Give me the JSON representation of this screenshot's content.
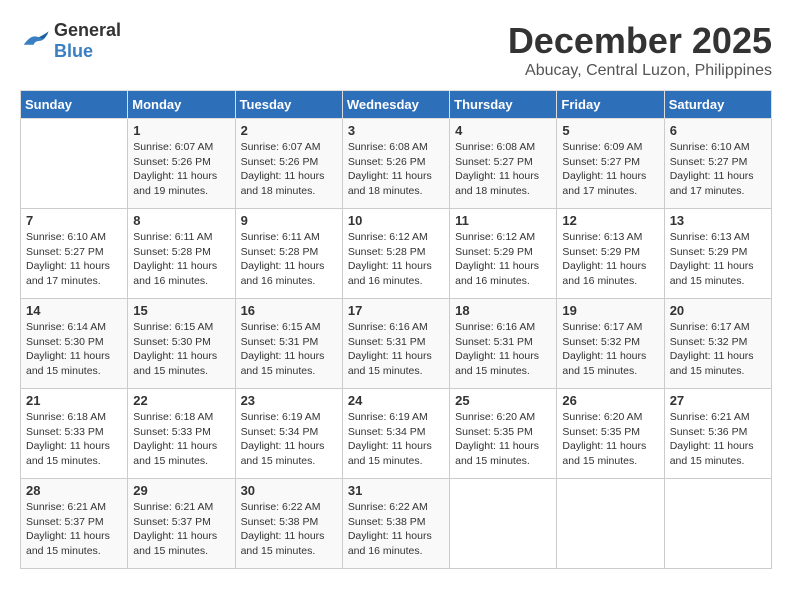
{
  "logo": {
    "general": "General",
    "blue": "Blue"
  },
  "title": {
    "month": "December 2025",
    "location": "Abucay, Central Luzon, Philippines"
  },
  "headers": [
    "Sunday",
    "Monday",
    "Tuesday",
    "Wednesday",
    "Thursday",
    "Friday",
    "Saturday"
  ],
  "weeks": [
    [
      {
        "day": "",
        "info": ""
      },
      {
        "day": "1",
        "info": "Sunrise: 6:07 AM\nSunset: 5:26 PM\nDaylight: 11 hours\nand 19 minutes."
      },
      {
        "day": "2",
        "info": "Sunrise: 6:07 AM\nSunset: 5:26 PM\nDaylight: 11 hours\nand 18 minutes."
      },
      {
        "day": "3",
        "info": "Sunrise: 6:08 AM\nSunset: 5:26 PM\nDaylight: 11 hours\nand 18 minutes."
      },
      {
        "day": "4",
        "info": "Sunrise: 6:08 AM\nSunset: 5:27 PM\nDaylight: 11 hours\nand 18 minutes."
      },
      {
        "day": "5",
        "info": "Sunrise: 6:09 AM\nSunset: 5:27 PM\nDaylight: 11 hours\nand 17 minutes."
      },
      {
        "day": "6",
        "info": "Sunrise: 6:10 AM\nSunset: 5:27 PM\nDaylight: 11 hours\nand 17 minutes."
      }
    ],
    [
      {
        "day": "7",
        "info": "Sunrise: 6:10 AM\nSunset: 5:27 PM\nDaylight: 11 hours\nand 17 minutes."
      },
      {
        "day": "8",
        "info": "Sunrise: 6:11 AM\nSunset: 5:28 PM\nDaylight: 11 hours\nand 16 minutes."
      },
      {
        "day": "9",
        "info": "Sunrise: 6:11 AM\nSunset: 5:28 PM\nDaylight: 11 hours\nand 16 minutes."
      },
      {
        "day": "10",
        "info": "Sunrise: 6:12 AM\nSunset: 5:28 PM\nDaylight: 11 hours\nand 16 minutes."
      },
      {
        "day": "11",
        "info": "Sunrise: 6:12 AM\nSunset: 5:29 PM\nDaylight: 11 hours\nand 16 minutes."
      },
      {
        "day": "12",
        "info": "Sunrise: 6:13 AM\nSunset: 5:29 PM\nDaylight: 11 hours\nand 16 minutes."
      },
      {
        "day": "13",
        "info": "Sunrise: 6:13 AM\nSunset: 5:29 PM\nDaylight: 11 hours\nand 15 minutes."
      }
    ],
    [
      {
        "day": "14",
        "info": "Sunrise: 6:14 AM\nSunset: 5:30 PM\nDaylight: 11 hours\nand 15 minutes."
      },
      {
        "day": "15",
        "info": "Sunrise: 6:15 AM\nSunset: 5:30 PM\nDaylight: 11 hours\nand 15 minutes."
      },
      {
        "day": "16",
        "info": "Sunrise: 6:15 AM\nSunset: 5:31 PM\nDaylight: 11 hours\nand 15 minutes."
      },
      {
        "day": "17",
        "info": "Sunrise: 6:16 AM\nSunset: 5:31 PM\nDaylight: 11 hours\nand 15 minutes."
      },
      {
        "day": "18",
        "info": "Sunrise: 6:16 AM\nSunset: 5:31 PM\nDaylight: 11 hours\nand 15 minutes."
      },
      {
        "day": "19",
        "info": "Sunrise: 6:17 AM\nSunset: 5:32 PM\nDaylight: 11 hours\nand 15 minutes."
      },
      {
        "day": "20",
        "info": "Sunrise: 6:17 AM\nSunset: 5:32 PM\nDaylight: 11 hours\nand 15 minutes."
      }
    ],
    [
      {
        "day": "21",
        "info": "Sunrise: 6:18 AM\nSunset: 5:33 PM\nDaylight: 11 hours\nand 15 minutes."
      },
      {
        "day": "22",
        "info": "Sunrise: 6:18 AM\nSunset: 5:33 PM\nDaylight: 11 hours\nand 15 minutes."
      },
      {
        "day": "23",
        "info": "Sunrise: 6:19 AM\nSunset: 5:34 PM\nDaylight: 11 hours\nand 15 minutes."
      },
      {
        "day": "24",
        "info": "Sunrise: 6:19 AM\nSunset: 5:34 PM\nDaylight: 11 hours\nand 15 minutes."
      },
      {
        "day": "25",
        "info": "Sunrise: 6:20 AM\nSunset: 5:35 PM\nDaylight: 11 hours\nand 15 minutes."
      },
      {
        "day": "26",
        "info": "Sunrise: 6:20 AM\nSunset: 5:35 PM\nDaylight: 11 hours\nand 15 minutes."
      },
      {
        "day": "27",
        "info": "Sunrise: 6:21 AM\nSunset: 5:36 PM\nDaylight: 11 hours\nand 15 minutes."
      }
    ],
    [
      {
        "day": "28",
        "info": "Sunrise: 6:21 AM\nSunset: 5:37 PM\nDaylight: 11 hours\nand 15 minutes."
      },
      {
        "day": "29",
        "info": "Sunrise: 6:21 AM\nSunset: 5:37 PM\nDaylight: 11 hours\nand 15 minutes."
      },
      {
        "day": "30",
        "info": "Sunrise: 6:22 AM\nSunset: 5:38 PM\nDaylight: 11 hours\nand 15 minutes."
      },
      {
        "day": "31",
        "info": "Sunrise: 6:22 AM\nSunset: 5:38 PM\nDaylight: 11 hours\nand 16 minutes."
      },
      {
        "day": "",
        "info": ""
      },
      {
        "day": "",
        "info": ""
      },
      {
        "day": "",
        "info": ""
      }
    ]
  ]
}
